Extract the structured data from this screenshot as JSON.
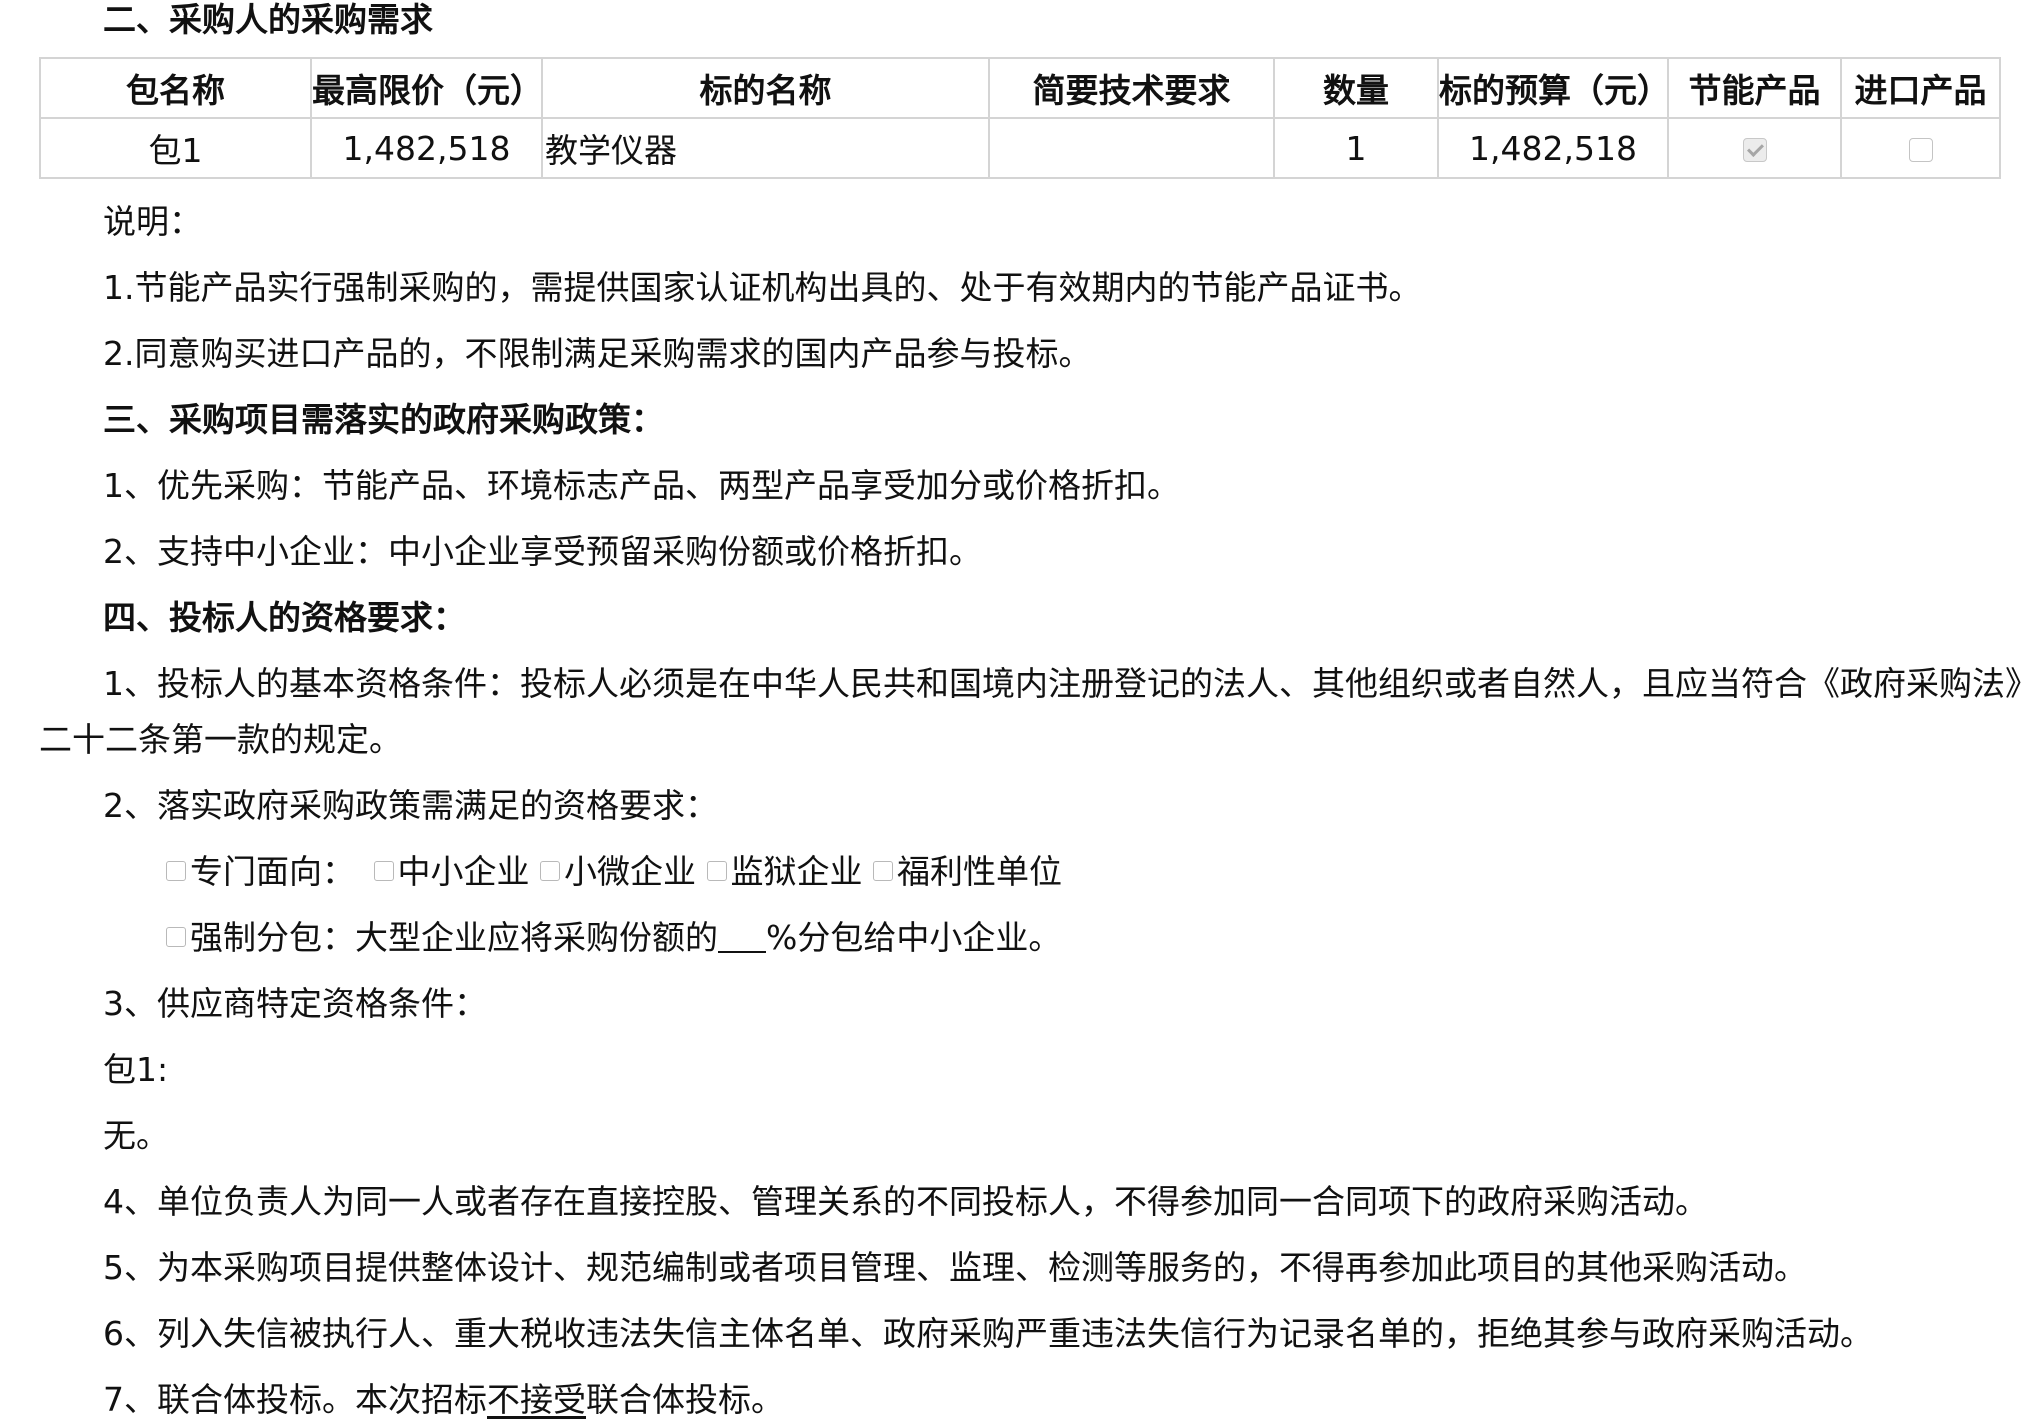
{
  "heading_2": "二、采购人的采购需求",
  "table": {
    "headers": [
      "包名称",
      "最高限价（元）",
      "标的名称",
      "简要技术要求",
      "数量",
      "标的预算（元）",
      "节能产品",
      "进口产品"
    ],
    "row": {
      "package": "包1",
      "max_price": "1,482,518",
      "item_name": "教学仪器",
      "tech_req": "",
      "quantity": "1",
      "budget": "1,482,518",
      "energy_saving": true,
      "imported": false
    }
  },
  "note_title": "说明：",
  "note_1": "1.节能产品实行强制采购的，需提供国家认证机构出具的、处于有效期内的节能产品证书。",
  "note_2": "2.同意购买进口产品的，不限制满足采购需求的国内产品参与投标。",
  "heading_3": "三、采购项目需落实的政府采购政策：",
  "policy_1": "1、优先采购：节能产品、环境标志产品、两型产品享受加分或价格折扣。",
  "policy_2": "2、支持中小企业：中小企业享受预留采购份额或价格折扣。",
  "heading_4": "四、投标人的资格要求：",
  "qual_1_a": "1、投标人的基本资格条件：投标人必须是在中华人民共和国境内注册登记的法人、其他组织或者自然人，且应当符合《政府采购法》第",
  "qual_1_b": "二十二条第一款的规定。",
  "qual_2": "2、落实政府采购政策需满足的资格要求：",
  "special": {
    "label": "专门面向：",
    "options": [
      "中小企业",
      "小微企业",
      "监狱企业",
      "福利性单位"
    ]
  },
  "subcontract": {
    "label": "强制分包：大型企业应将采购份额的",
    "suffix": "%分包给中小企业。"
  },
  "qual_3": "3、供应商特定资格条件：",
  "pkg_label": "包1:",
  "pkg_value": "无。",
  "qual_4": "4、单位负责人为同一人或者存在直接控股、管理关系的不同投标人，不得参加同一合同项下的政府采购活动。",
  "qual_5": "5、为本采购项目提供整体设计、规范编制或者项目管理、监理、检测等服务的，不得再参加此项目的其他采购活动。",
  "qual_6": "6、列入失信被执行人、重大税收违法失信主体名单、政府采购严重违法失信行为记录名单的，拒绝其参与政府采购活动。",
  "qual_7": {
    "before": "7、联合体投标。本次招标",
    "underlined": "不接受",
    "after": "联合体投标。"
  }
}
